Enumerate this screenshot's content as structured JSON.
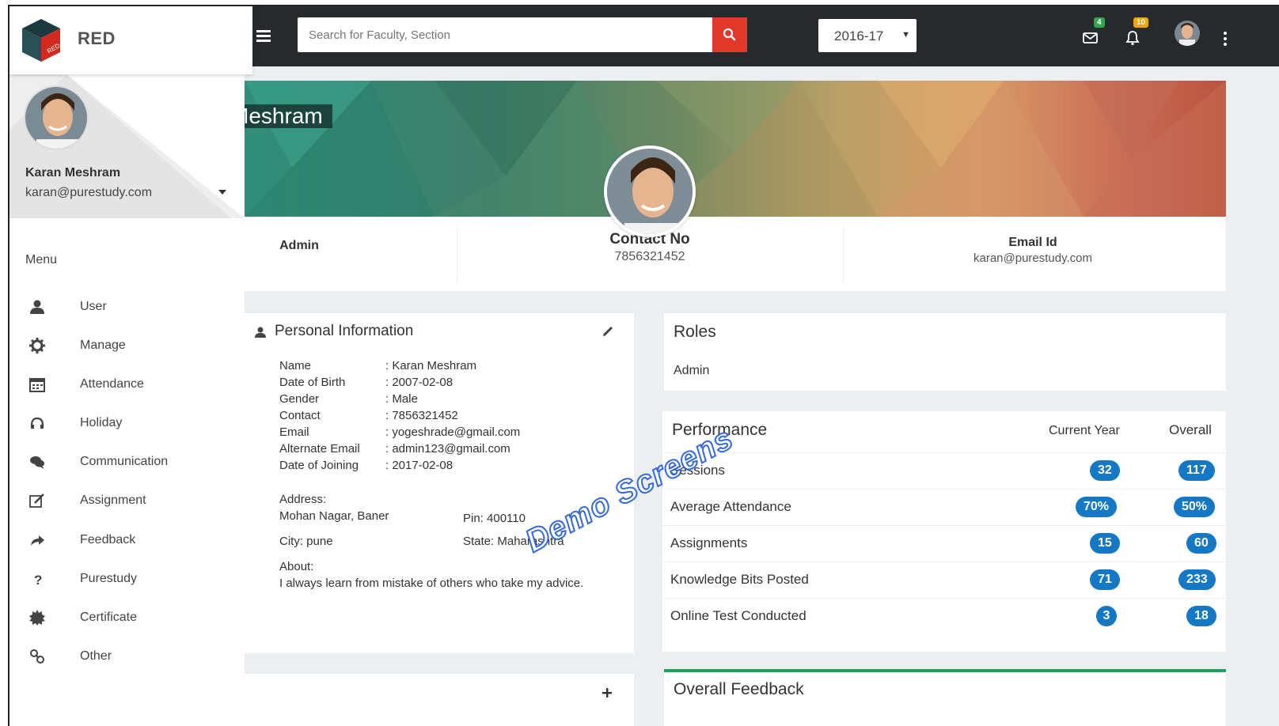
{
  "brand": {
    "name": "RED",
    "logo_tag": "RED"
  },
  "topbar": {
    "search_placeholder": "Search for Faculty, Section",
    "year": "2016-17",
    "mail_badge": "4",
    "bell_badge": "10",
    "accent": "#e0392b"
  },
  "sidebar": {
    "user_name": "Karan Meshram",
    "user_email": "karan@purestudy.com",
    "menu_heading": "Menu",
    "items": [
      {
        "label": "User",
        "icon": "user-icon"
      },
      {
        "label": "Manage",
        "icon": "gear-icon"
      },
      {
        "label": "Attendance",
        "icon": "calendar-icon"
      },
      {
        "label": "Holiday",
        "icon": "headphones-icon"
      },
      {
        "label": "Communication",
        "icon": "chat-icon"
      },
      {
        "label": "Assignment",
        "icon": "edit-icon"
      },
      {
        "label": "Feedback",
        "icon": "share-icon"
      },
      {
        "label": "Purestudy",
        "icon": "question-icon"
      },
      {
        "label": "Certificate",
        "icon": "certificate-icon"
      },
      {
        "label": "Other",
        "icon": "link-icon"
      }
    ]
  },
  "banner": {
    "name_fragment": "Meshram"
  },
  "info": {
    "role": "Admin",
    "contact_label": "Contact No",
    "contact_value": "7856321452",
    "email_label": "Email Id",
    "email_value": "karan@purestudy.com"
  },
  "personal": {
    "title": "Personal Information",
    "rows": [
      {
        "k": "Name",
        "v": ": Karan Meshram"
      },
      {
        "k": "Date of Birth",
        "v": ": 2007-02-08"
      },
      {
        "k": "Gender",
        "v": ": Male"
      },
      {
        "k": "Contact",
        "v": ": 7856321452"
      },
      {
        "k": "Email",
        "v": ": yogeshrade@gmail.com"
      },
      {
        "k": "Alternate Email",
        "v": ": admin123@gmail.com"
      },
      {
        "k": "Date of Joining",
        "v": ": 2017-02-08"
      }
    ],
    "address_label": "Address:",
    "address": "Mohan Nagar, Baner",
    "pin": "Pin: 400110",
    "city": "City: pune",
    "state": "State: Maharashtra",
    "about_label": "About:",
    "about": "I always learn from mistake of others who take my advice."
  },
  "roles": {
    "title": "Roles",
    "value": "Admin"
  },
  "performance": {
    "title": "Performance",
    "col_current": "Current Year",
    "col_overall": "Overall",
    "rows": [
      {
        "label": "Sessions",
        "current": "32",
        "overall": "117"
      },
      {
        "label": "Average Attendance",
        "current": "70%",
        "overall": "50%"
      },
      {
        "label": "Assignments",
        "current": "15",
        "overall": "60"
      },
      {
        "label": "Knowledge Bits Posted",
        "current": "71",
        "overall": "233"
      },
      {
        "label": "Online Test Conducted",
        "current": "3",
        "overall": "18"
      }
    ]
  },
  "feedback": {
    "title": "Overall Feedback"
  },
  "watermark": "Demo Screens"
}
